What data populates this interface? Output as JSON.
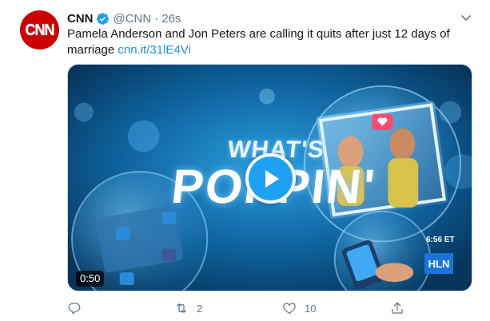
{
  "tweet": {
    "avatar_text": "CNN",
    "name": "CNN",
    "handle": "@CNN",
    "separator": "·",
    "time": "26s",
    "text": "Pamela Anderson and Jon Peters are calling it quits after just 12 days of marriage",
    "link": "cnn.it/31lE4Vi"
  },
  "media": {
    "title_line1": "WHAT'S",
    "title_line2": "POPPIN'",
    "duration": "0:50",
    "clock": "6:56 ET",
    "network": "HLN"
  },
  "actions": {
    "reply_count": "",
    "retweet_count": "2",
    "like_count": "10"
  },
  "icons": [
    "verified-icon",
    "chevron-down-icon",
    "play-icon",
    "reply-icon",
    "retweet-icon",
    "like-icon",
    "share-icon"
  ],
  "colors": {
    "accent": "#1da1f2",
    "link": "#1b95e0",
    "muted": "#657786",
    "brand": "#cc0000"
  }
}
